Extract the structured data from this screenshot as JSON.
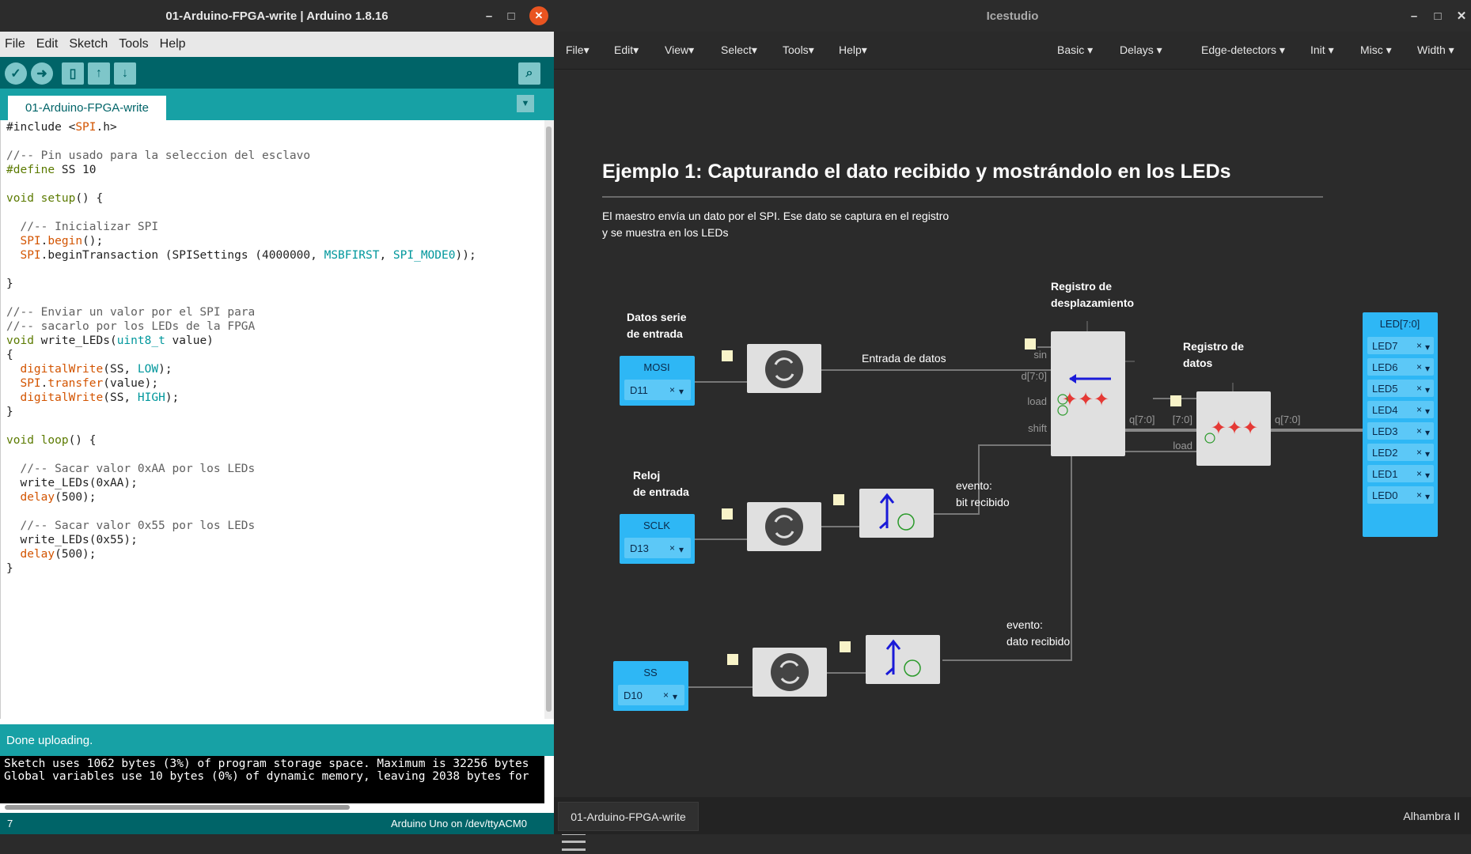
{
  "arduino": {
    "title": "01-Arduino-FPGA-write | Arduino 1.8.16",
    "window_controls": {
      "minimize": "–",
      "maximize": "□",
      "close": "✕"
    },
    "menu": [
      "File",
      "Edit",
      "Sketch",
      "Tools",
      "Help"
    ],
    "toolbar_icons": [
      "verify-icon",
      "upload-icon",
      "new-icon",
      "open-icon",
      "save-icon",
      "serial-monitor-icon"
    ],
    "tab_label": "01-Arduino-FPGA-write",
    "tab_menu": "▼",
    "status": "Done uploading.",
    "console_lines": [
      "Sketch uses 1062 bytes (3%) of program storage space. Maximum is 32256 bytes",
      "Global variables use 10 bytes (0%) of dynamic memory, leaving 2038 bytes for"
    ],
    "footer_line": "7",
    "footer_board": "Arduino Uno on /dev/ttyACM0",
    "code_lines": [
      [
        [
          "#include <",
          "t"
        ],
        [
          "SPI",
          "o"
        ],
        [
          ".h>",
          "t"
        ]
      ],
      [],
      [
        [
          "//-- Pin usado para la seleccion del esclavo",
          "c"
        ]
      ],
      [
        [
          "#define",
          "k"
        ],
        [
          " SS 10",
          "t"
        ]
      ],
      [],
      [
        [
          "void",
          "k"
        ],
        [
          " ",
          "t"
        ],
        [
          "setup",
          "k"
        ],
        [
          "() {",
          "t"
        ]
      ],
      [],
      [
        [
          "  //-- Inicializar SPI",
          "c"
        ]
      ],
      [
        [
          "  ",
          "t"
        ],
        [
          "SPI",
          "o"
        ],
        [
          ".",
          "t"
        ],
        [
          "begin",
          "o"
        ],
        [
          "();",
          "t"
        ]
      ],
      [
        [
          "  ",
          "t"
        ],
        [
          "SPI",
          "o"
        ],
        [
          ".beginTransaction (SPISettings (4000000, ",
          "t"
        ],
        [
          "MSBFIRST",
          "b"
        ],
        [
          ", ",
          "t"
        ],
        [
          "SPI_MODE0",
          "b"
        ],
        [
          "));",
          "t"
        ]
      ],
      [],
      [
        [
          "}",
          "t"
        ]
      ],
      [],
      [
        [
          "//-- Enviar un valor por el SPI para",
          "c"
        ]
      ],
      [
        [
          "//-- sacarlo por los LEDs de la FPGA",
          "c"
        ]
      ],
      [
        [
          "void",
          "k"
        ],
        [
          " write_LEDs(",
          "t"
        ],
        [
          "uint8_t",
          "b"
        ],
        [
          " value)",
          "t"
        ]
      ],
      [
        [
          "{",
          "t"
        ]
      ],
      [
        [
          "  ",
          "t"
        ],
        [
          "digitalWrite",
          "o"
        ],
        [
          "(SS, ",
          "t"
        ],
        [
          "LOW",
          "b"
        ],
        [
          ");",
          "t"
        ]
      ],
      [
        [
          "  ",
          "t"
        ],
        [
          "SPI",
          "o"
        ],
        [
          ".",
          "t"
        ],
        [
          "transfer",
          "o"
        ],
        [
          "(value);",
          "t"
        ]
      ],
      [
        [
          "  ",
          "t"
        ],
        [
          "digitalWrite",
          "o"
        ],
        [
          "(SS, ",
          "t"
        ],
        [
          "HIGH",
          "b"
        ],
        [
          ");",
          "t"
        ]
      ],
      [
        [
          "}",
          "t"
        ]
      ],
      [],
      [
        [
          "void",
          "k"
        ],
        [
          " ",
          "t"
        ],
        [
          "loop",
          "k"
        ],
        [
          "() {",
          "t"
        ]
      ],
      [],
      [
        [
          "  //-- Sacar valor 0xAA por los LEDs",
          "c"
        ]
      ],
      [
        [
          "  write_LEDs(0xAA);",
          "t"
        ]
      ],
      [
        [
          "  ",
          "t"
        ],
        [
          "delay",
          "o"
        ],
        [
          "(500);",
          "t"
        ]
      ],
      [],
      [
        [
          "  //-- Sacar valor 0x55 por los LEDs",
          "c"
        ]
      ],
      [
        [
          "  write_LEDs(0x55);",
          "t"
        ]
      ],
      [
        [
          "  ",
          "t"
        ],
        [
          "delay",
          "o"
        ],
        [
          "(500);",
          "t"
        ]
      ],
      [
        [
          "}",
          "t"
        ]
      ]
    ]
  },
  "icestudio": {
    "title": "Icestudio",
    "window_controls": {
      "minimize": "–",
      "maximize": "□",
      "close": "✕"
    },
    "menu_left": [
      "File",
      "Edit",
      "View",
      "Select",
      "Tools",
      "Help"
    ],
    "menu_right": [
      "Basic",
      "Delays",
      "Edge-detectors",
      "Init",
      "Misc",
      "Width"
    ],
    "heading": "Ejemplo 1: Capturando el dato recibido y mostrándolo en los LEDs",
    "description": [
      "El maestro envía un dato por el SPI. Ese dato se captura en el registro",
      "y se muestra en los LEDs"
    ],
    "labels": {
      "datos_serie": [
        "Datos serie",
        "de entrada"
      ],
      "reloj": [
        "Reloj",
        "de entrada"
      ],
      "registro_desp": [
        "Registro de",
        "desplazamiento"
      ],
      "registro_datos": [
        "Registro de",
        "datos"
      ],
      "entrada_datos": "Entrada de datos",
      "evento_bit": [
        "evento:",
        "bit recibido"
      ],
      "evento_dato": [
        "evento:",
        "dato recibido"
      ]
    },
    "inputs": [
      {
        "name": "MOSI",
        "pin": "D11"
      },
      {
        "name": "SCLK",
        "pin": "D13"
      },
      {
        "name": "SS",
        "pin": "D10"
      }
    ],
    "ports": {
      "sin": "sin",
      "d": "d[7:0]",
      "load": "load",
      "shift": "shift",
      "q": "q[7:0]",
      "bus": "[7:0]",
      "q2": "q[7:0]",
      "load2": "load"
    },
    "output": {
      "name": "LED[7:0]",
      "leds": [
        "LED7",
        "LED6",
        "LED5",
        "LED4",
        "LED3",
        "LED2",
        "LED1",
        "LED0"
      ]
    },
    "clear_glyph": "×",
    "dropdown_glyph": "▾",
    "tab_label": "01-Arduino-FPGA-write",
    "board": "Alhambra II",
    "colors": {
      "input_block": "#2eb7f5",
      "grey_block": "#e0e0e0",
      "accent_red": "#e53935",
      "arrow_blue": "#1a1ad8"
    }
  }
}
